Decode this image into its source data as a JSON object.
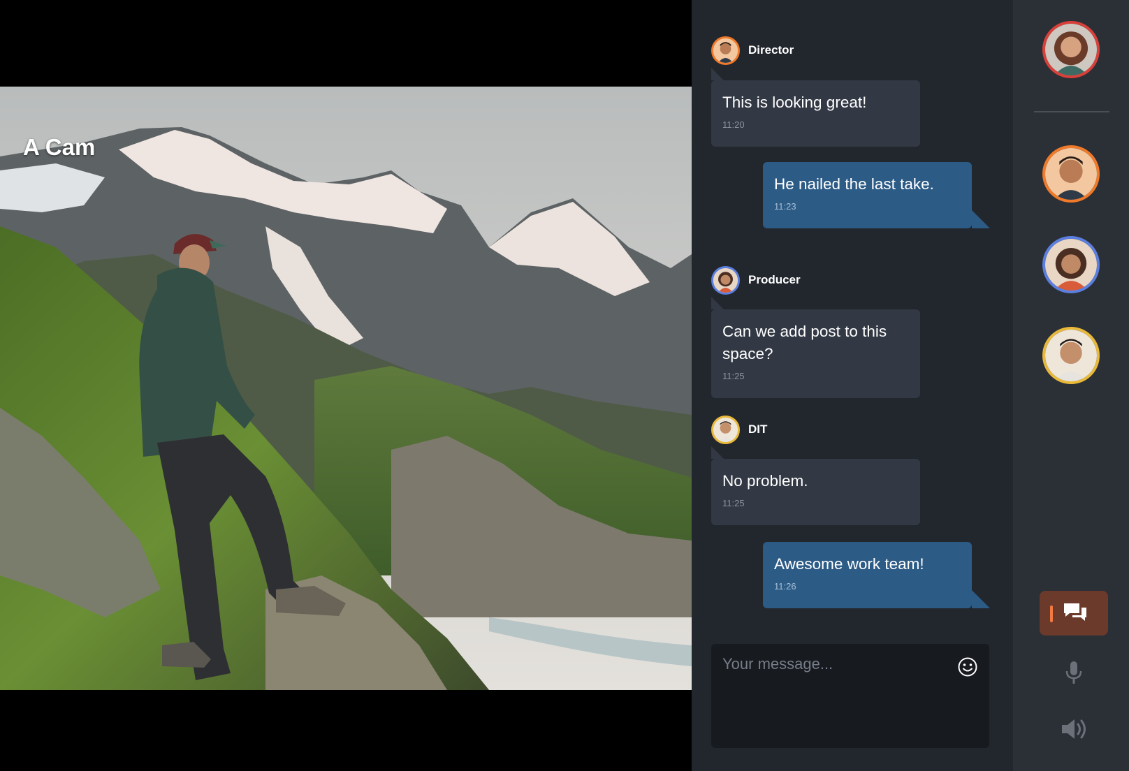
{
  "video": {
    "camera_label": "A Cam"
  },
  "chat": {
    "messages": [
      {
        "sender": "Director",
        "avatar": "director-avatar",
        "text": "This is looking great!",
        "time": "11:20",
        "direction": "incoming"
      },
      {
        "sender": "",
        "avatar": "",
        "text": "He nailed the last take.",
        "time": "11:23",
        "direction": "outgoing"
      },
      {
        "sender": "Producer",
        "avatar": "producer-avatar",
        "text": "Can we add post to this space?",
        "time": "11:25",
        "direction": "incoming"
      },
      {
        "sender": "DIT",
        "avatar": "dit-avatar",
        "text": "No problem.",
        "time": "11:25",
        "direction": "incoming"
      },
      {
        "sender": "",
        "avatar": "",
        "text": "Awesome work team!",
        "time": "11:26",
        "direction": "outgoing"
      }
    ],
    "composer": {
      "placeholder": "Your message...",
      "value": ""
    }
  },
  "rail": {
    "participants": [
      {
        "name": "self",
        "ring_color": "#d9403a"
      },
      {
        "name": "director",
        "ring_color": "#f07a2a"
      },
      {
        "name": "producer",
        "ring_color": "#5b7fe0"
      },
      {
        "name": "dit",
        "ring_color": "#e9b93a"
      }
    ],
    "controls": [
      "chat-icon",
      "microphone-icon",
      "speaker-icon"
    ]
  },
  "colors": {
    "accent": "#f07a42",
    "outgoing_bubble": "#2c5b86",
    "incoming_bubble": "#323944",
    "panel_bg": "#22262d",
    "rail_bg": "#2b2f36"
  }
}
